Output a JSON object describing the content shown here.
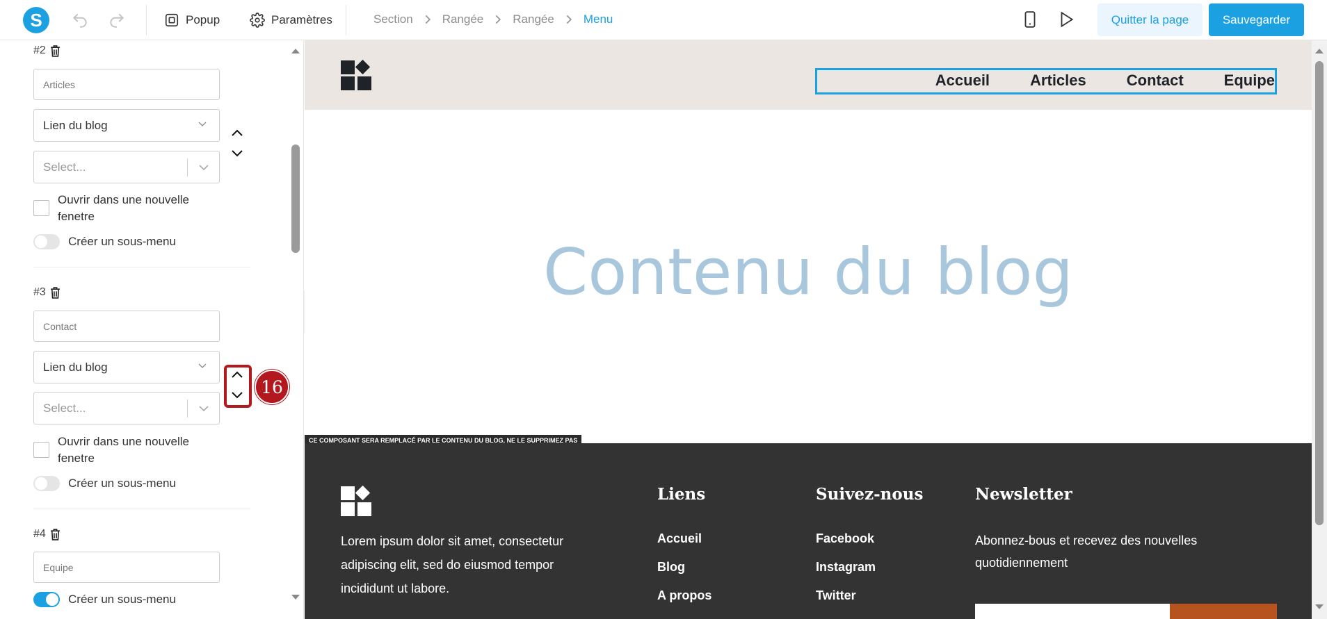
{
  "app": {
    "logo_letter": "S",
    "accent": "#1ba1e2",
    "toolbar": {
      "undo_icon": "undo-icon",
      "redo_icon": "redo-icon",
      "popup_label": "Popup",
      "settings_label": "Paramètres",
      "mobile_icon": "mobile-icon",
      "play_icon": "play-icon",
      "quit_label": "Quitter la page",
      "save_label": "Sauvegarder"
    },
    "breadcrumb": [
      "Section",
      "Rangée",
      "Rangée",
      "Menu"
    ]
  },
  "panel": {
    "items": [
      {
        "number": "#2",
        "label_value": "Articles",
        "link_type": "Lien du blog",
        "target_placeholder": "Select...",
        "new_window_label": "Ouvrir dans une nouvelle fenetre",
        "new_window_checked": false,
        "submenu_label": "Créer un sous-menu",
        "submenu_on": false
      },
      {
        "number": "#3",
        "label_value": "Contact",
        "link_type": "Lien du blog",
        "target_placeholder": "Select...",
        "new_window_label": "Ouvrir dans une nouvelle fenetre",
        "new_window_checked": false,
        "submenu_label": "Créer un sous-menu",
        "submenu_on": false
      },
      {
        "number": "#4",
        "label_value": "Equipe",
        "submenu_label": "Créer un sous-menu",
        "submenu_on": true
      }
    ],
    "step_badge": "16",
    "highlight_color": "#b3181f"
  },
  "preview": {
    "nav": [
      "Accueil",
      "Articles",
      "Contact",
      "Equipe"
    ],
    "title": "Contenu du blog",
    "notice": "CE COMPOSANT SERA REMPLACÉ PAR LE CONTENU DU BLOG, NE LE SUPPRIMEZ PAS",
    "footer": {
      "lorem": "Lorem ipsum dolor sit amet, consectetur adipiscing elit, sed do eiusmod tempor incididunt ut labore.",
      "links_title": "Liens",
      "links": [
        "Accueil",
        "Blog",
        "A propos"
      ],
      "follow_title": "Suivez-nous",
      "follow": [
        "Facebook",
        "Instagram",
        "Twitter"
      ],
      "newsletter_title": "Newsletter",
      "newsletter_text": "Abonnez-bous et recevez des nouvelles quotidiennement",
      "button_color": "#b7531f"
    },
    "header_bg": "#ece6e3",
    "footer_bg": "#333333"
  }
}
